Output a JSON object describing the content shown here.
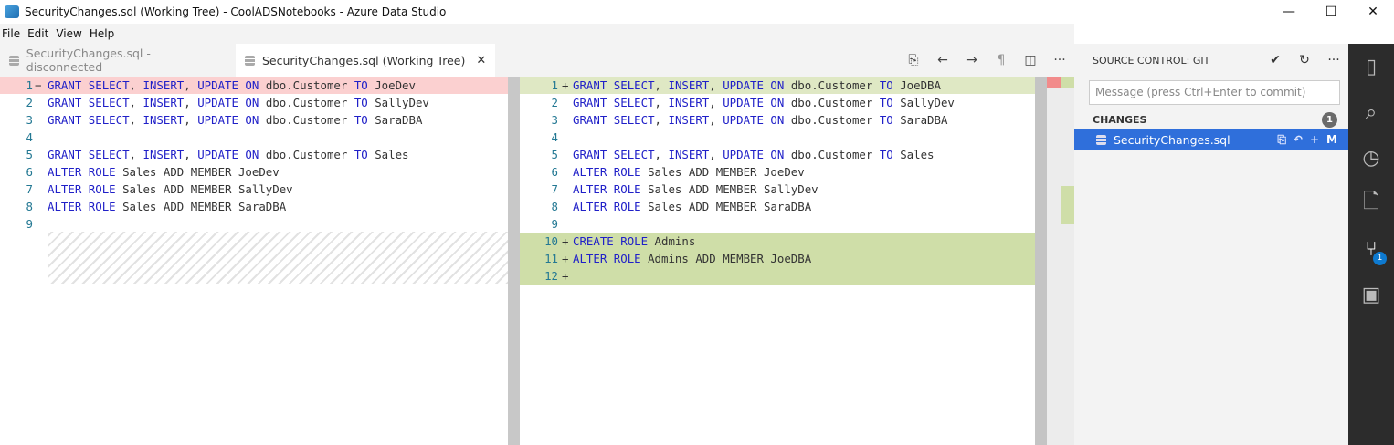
{
  "window": {
    "title": "SecurityChanges.sql (Working Tree) - CoolADSNotebooks - Azure Data Studio"
  },
  "menu": [
    "File",
    "Edit",
    "View",
    "Help"
  ],
  "tabs": [
    {
      "label": "SecurityChanges.sql - disconnected",
      "active": false
    },
    {
      "label": "SecurityChanges.sql (Working Tree)",
      "active": true
    }
  ],
  "left_lines": [
    {
      "n": "1",
      "m": "−",
      "text": "GRANT SELECT, INSERT, UPDATE ON dbo.Customer TO JoeDev",
      "state": "del"
    },
    {
      "n": "2",
      "m": "",
      "text": "GRANT SELECT, INSERT, UPDATE ON dbo.Customer TO SallyDev",
      "state": ""
    },
    {
      "n": "3",
      "m": "",
      "text": "GRANT SELECT, INSERT, UPDATE ON dbo.Customer TO SaraDBA",
      "state": ""
    },
    {
      "n": "4",
      "m": "",
      "text": "",
      "state": ""
    },
    {
      "n": "5",
      "m": "",
      "text": "GRANT SELECT, INSERT, UPDATE ON dbo.Customer TO Sales",
      "state": ""
    },
    {
      "n": "6",
      "m": "",
      "text": "ALTER ROLE Sales ADD MEMBER JoeDev",
      "state": ""
    },
    {
      "n": "7",
      "m": "",
      "text": "ALTER ROLE Sales ADD MEMBER SallyDev",
      "state": ""
    },
    {
      "n": "8",
      "m": "",
      "text": "ALTER ROLE Sales ADD MEMBER SaraDBA",
      "state": ""
    },
    {
      "n": "9",
      "m": "",
      "text": "",
      "state": ""
    }
  ],
  "right_lines": [
    {
      "n": "1",
      "m": "+",
      "text": "GRANT SELECT, INSERT, UPDATE ON dbo.Customer TO JoeDBA",
      "state": "ins"
    },
    {
      "n": "2",
      "m": "",
      "text": "GRANT SELECT, INSERT, UPDATE ON dbo.Customer TO SallyDev",
      "state": ""
    },
    {
      "n": "3",
      "m": "",
      "text": "GRANT SELECT, INSERT, UPDATE ON dbo.Customer TO SaraDBA",
      "state": ""
    },
    {
      "n": "4",
      "m": "",
      "text": "",
      "state": ""
    },
    {
      "n": "5",
      "m": "",
      "text": "GRANT SELECT, INSERT, UPDATE ON dbo.Customer TO Sales",
      "state": ""
    },
    {
      "n": "6",
      "m": "",
      "text": "ALTER ROLE Sales ADD MEMBER JoeDev",
      "state": ""
    },
    {
      "n": "7",
      "m": "",
      "text": "ALTER ROLE Sales ADD MEMBER SallyDev",
      "state": ""
    },
    {
      "n": "8",
      "m": "",
      "text": "ALTER ROLE Sales ADD MEMBER SaraDBA",
      "state": ""
    },
    {
      "n": "9",
      "m": "",
      "text": "",
      "state": ""
    },
    {
      "n": "10",
      "m": "+",
      "text": "CREATE ROLE Admins",
      "state": "ins-strong"
    },
    {
      "n": "11",
      "m": "+",
      "text": "ALTER ROLE Admins ADD MEMBER JoeDBA",
      "state": "ins-strong"
    },
    {
      "n": "12",
      "m": "+",
      "text": "",
      "state": "ins-strong"
    }
  ],
  "scm": {
    "title": "SOURCE CONTROL: GIT",
    "message_placeholder": "Message (press Ctrl+Enter to commit)",
    "section": "CHANGES",
    "count": "1",
    "file": "SecurityChanges.sql",
    "file_status": "M"
  },
  "activity_badge": "1"
}
